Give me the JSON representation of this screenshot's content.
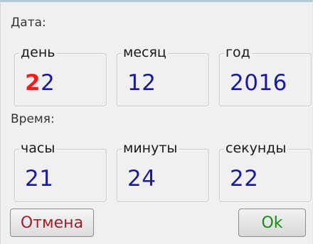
{
  "date_section": {
    "label": "Дата:",
    "day": {
      "title": "день",
      "value_prefix": "2",
      "value_rest": "2"
    },
    "month": {
      "title": "месяц",
      "value": "12"
    },
    "year": {
      "title": "год",
      "value": "2016"
    }
  },
  "time_section": {
    "label": "Время:",
    "hours": {
      "title": "часы",
      "value": "21"
    },
    "minutes": {
      "title": "минуты",
      "value": "24"
    },
    "seconds": {
      "title": "секунды",
      "value": "22"
    }
  },
  "buttons": {
    "cancel_label": "Отмена",
    "ok_label": "Ok"
  },
  "colors": {
    "value_text": "#1a1a9e",
    "active_digit": "#ff1a1a",
    "cancel_text": "#a0202a",
    "ok_text": "#1a8a1a"
  }
}
